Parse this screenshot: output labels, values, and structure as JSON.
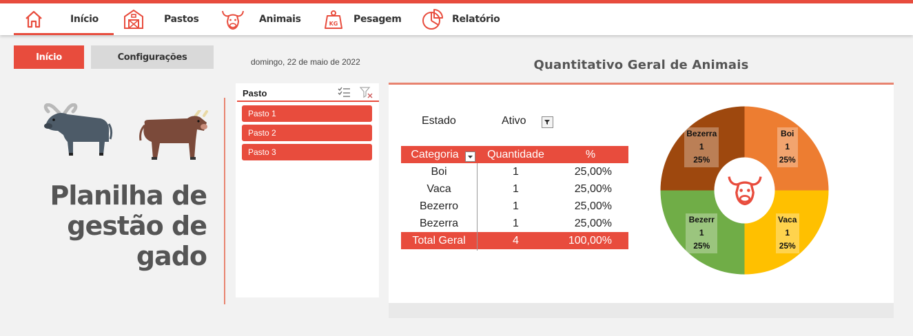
{
  "nav": {
    "items": [
      {
        "label": "Início",
        "icon": "home-icon"
      },
      {
        "label": "Pastos",
        "icon": "barn-icon"
      },
      {
        "label": "Animais",
        "icon": "bull-head-icon"
      },
      {
        "label": "Pesagem",
        "icon": "weight-kg-icon"
      },
      {
        "label": "Relatório",
        "icon": "pie-chart-icon"
      }
    ]
  },
  "buttons": {
    "home": "Início",
    "settings": "Configurações"
  },
  "date": "domingo, 22 de maio de 2022",
  "hero": {
    "line1": "Planilha de",
    "line2": "gestão de",
    "line3": "gado",
    "icons": [
      "water-buffalo-icon",
      "ox-icon"
    ]
  },
  "slicer": {
    "title": "Pasto",
    "items": [
      "Pasto 1",
      "Pasto 2",
      "Pasto 3"
    ]
  },
  "dashboard": {
    "title": "Quantitativo Geral de Animais",
    "filter": {
      "label": "Estado",
      "value": "Ativo"
    },
    "table": {
      "headers": [
        "Categoria",
        "Quantidade",
        "%"
      ],
      "rows": [
        [
          "Boi",
          "1",
          "25,00%"
        ],
        [
          "Vaca",
          "1",
          "25,00%"
        ],
        [
          "Bezerro",
          "1",
          "25,00%"
        ],
        [
          "Bezerra",
          "1",
          "25,00%"
        ]
      ],
      "total": [
        "Total Geral",
        "4",
        "100,00%"
      ]
    }
  },
  "chart_data": {
    "type": "pie",
    "categories": [
      "Boi",
      "Vaca",
      "Bezerro",
      "Bezerra"
    ],
    "values": [
      1,
      1,
      1,
      1
    ],
    "percent_labels": [
      "25%",
      "25%",
      "25%",
      "25%"
    ],
    "value_labels": [
      "1",
      "1",
      "1",
      "1"
    ],
    "display_labels": [
      "Boi",
      "Vaca",
      "Bezerr",
      "Bezerra"
    ],
    "colors": [
      "#ed7d31",
      "#ffc000",
      "#70ad47",
      "#9e480e"
    ],
    "center_icon": "bull-head-icon",
    "legend": "none"
  },
  "colors": {
    "accent": "#e84c3d"
  }
}
